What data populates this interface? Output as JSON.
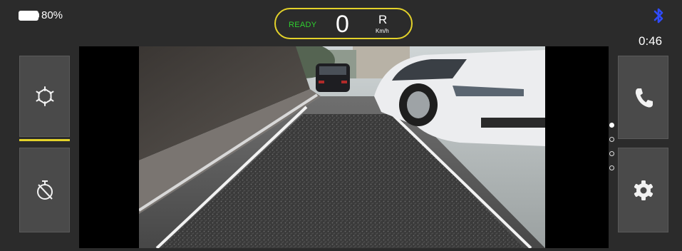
{
  "status": {
    "battery_percent": "80%",
    "battery_level": 0.8,
    "clock": "0:46"
  },
  "speedometer": {
    "state": "READY",
    "speed": "0",
    "gear": "R",
    "unit": "Km/h",
    "accent_color": "#e3d22a",
    "ready_color": "#2fcf2f"
  },
  "left_panel": {
    "items": [
      {
        "icon": "snowflake-icon",
        "active": true
      },
      {
        "icon": "timer-off-icon",
        "active": false
      }
    ]
  },
  "right_panel": {
    "items": [
      {
        "icon": "phone-icon"
      },
      {
        "icon": "gear-icon"
      }
    ]
  },
  "camera": {
    "view": "rear-camera-feed"
  },
  "pagination": {
    "total": 4,
    "current": 1
  },
  "colors": {
    "background": "#2b2b2b",
    "button_bg": "#4a4a4a",
    "bluetooth": "#2f4bff"
  }
}
